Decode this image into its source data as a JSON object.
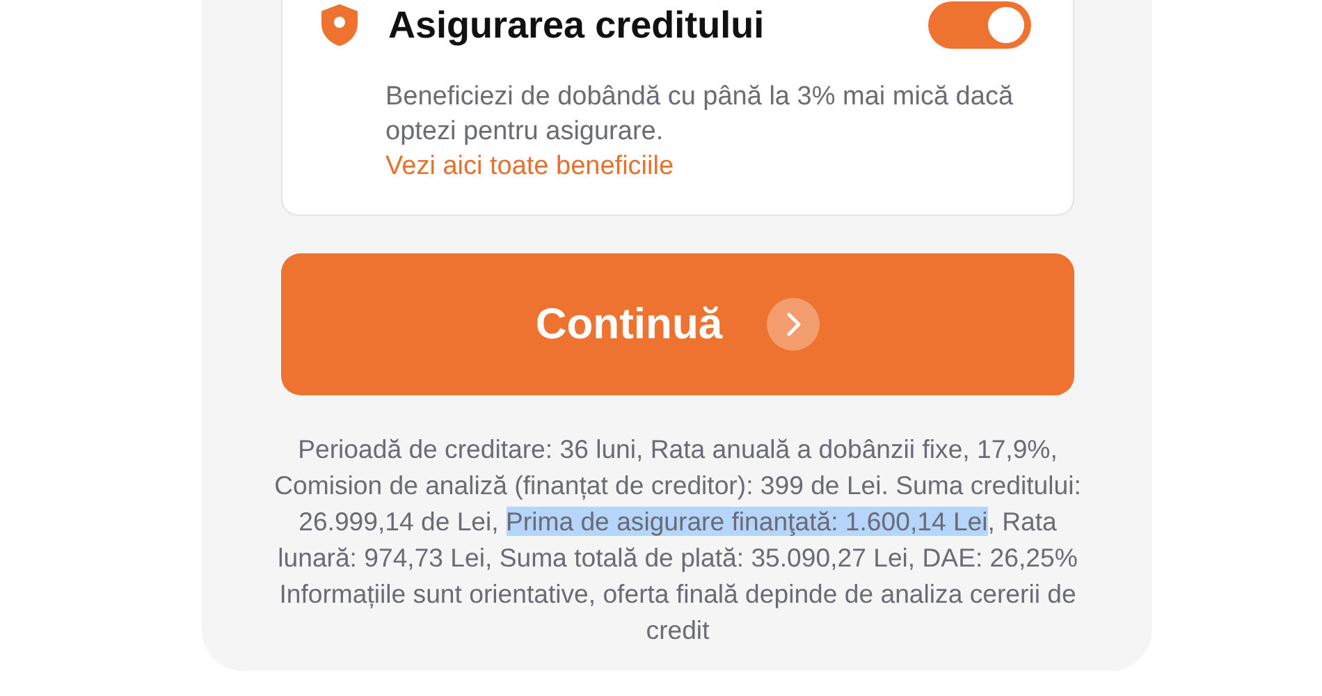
{
  "insurance_card": {
    "title": "Asigurarea creditului",
    "toggle": {
      "on": true
    },
    "description": "Beneficiezi de dobândă cu până la 3% mai mică dacă optezi pentru asigurare.",
    "link": "Vezi aici toate beneficiile"
  },
  "continue_button": {
    "label": "Continuă"
  },
  "disclaimer": {
    "segments": [
      {
        "text": "Perioadă de creditare: 36 luni, Rata anuală a dobânzii fixe, 17,9%, Comision de analiză (finanțat de creditor): 399 de Lei. Suma creditului: 26.999,14 de Lei, ",
        "highlighted": false
      },
      {
        "text": "Prima de asigurare finanţată: 1.600,14 Lei",
        "highlighted": true
      },
      {
        "text": ", Rata lunară: 974,73 Lei, Suma totală de plată: 35.090,27 Lei, DAE: 26,25% Informațiile sunt orientative, oferta finală depinde de analiza cererii de credit",
        "highlighted": false
      }
    ]
  }
}
